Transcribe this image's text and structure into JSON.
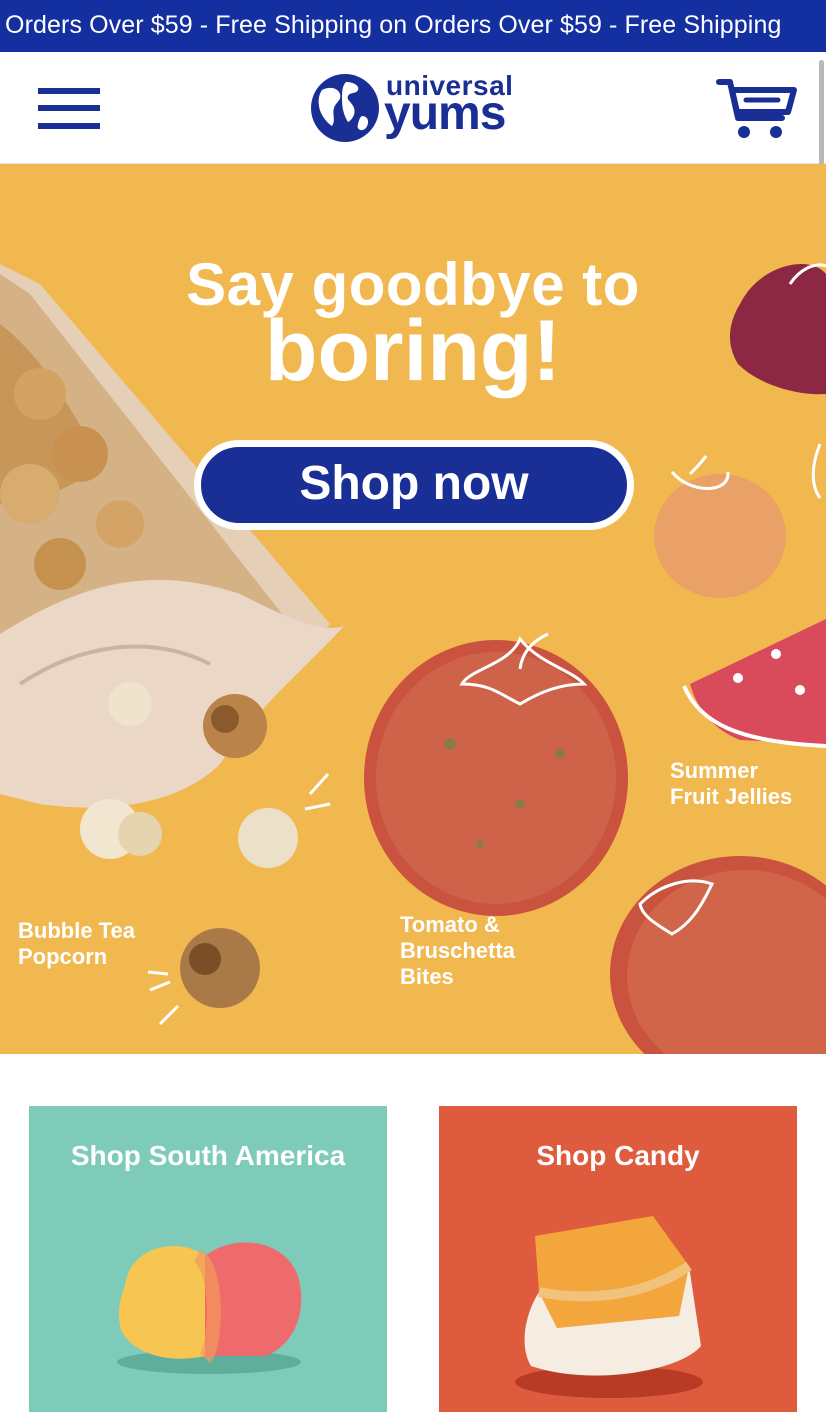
{
  "promo": {
    "text": "n Orders Over $59 - Free Shipping on Orders Over $59 - Free Shipping"
  },
  "header": {
    "logo_line1": "universal",
    "logo_line2": "yums",
    "menu_icon": "hamburger-menu-icon",
    "cart_icon": "shopping-cart-icon"
  },
  "hero": {
    "headline_line1": "Say goodbye to",
    "headline_line2": "boring!",
    "cta_label": "Shop now",
    "labels": {
      "popcorn": [
        "Bubble Tea",
        "Popcorn"
      ],
      "tomato": [
        "Tomato &",
        "Bruschetta",
        "Bites"
      ],
      "jellies": [
        "Summer",
        "Fruit Jellies"
      ]
    }
  },
  "categories": [
    {
      "title": "Shop South America",
      "color": "#7ecbb9"
    },
    {
      "title": "Shop Candy",
      "color": "#de5b3e"
    }
  ],
  "colors": {
    "brand_blue": "#1a2f96",
    "promo_bar": "#1430a0",
    "hero_background": "#f1b84f"
  }
}
